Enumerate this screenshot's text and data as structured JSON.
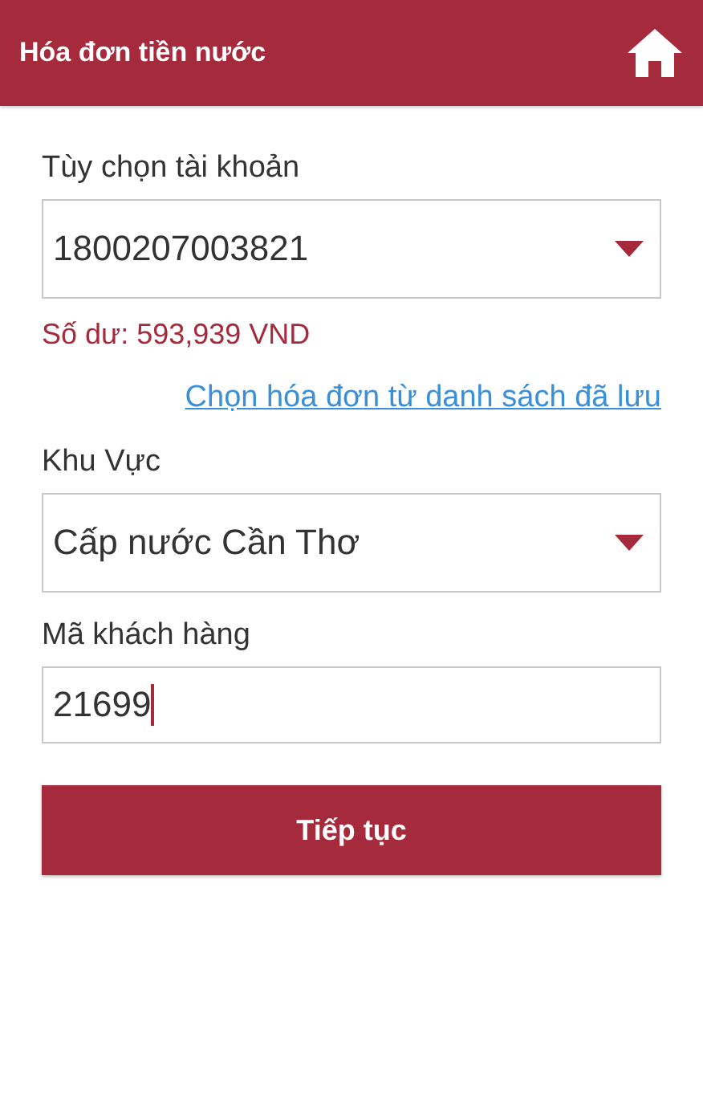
{
  "header": {
    "title": "Hóa đơn tiền nước"
  },
  "account": {
    "label": "Tùy chọn tài khoản",
    "value": "1800207003821",
    "balance": "Số dư: 593,939 VND"
  },
  "saved_link": "Chọn hóa đơn từ danh sách đã lưu",
  "region": {
    "label": "Khu Vực",
    "value": "Cấp nước Cần Thơ"
  },
  "customer_code": {
    "label": "Mã khách hàng",
    "value": "21699",
    "focused": true
  },
  "submit": "Tiếp tục"
}
